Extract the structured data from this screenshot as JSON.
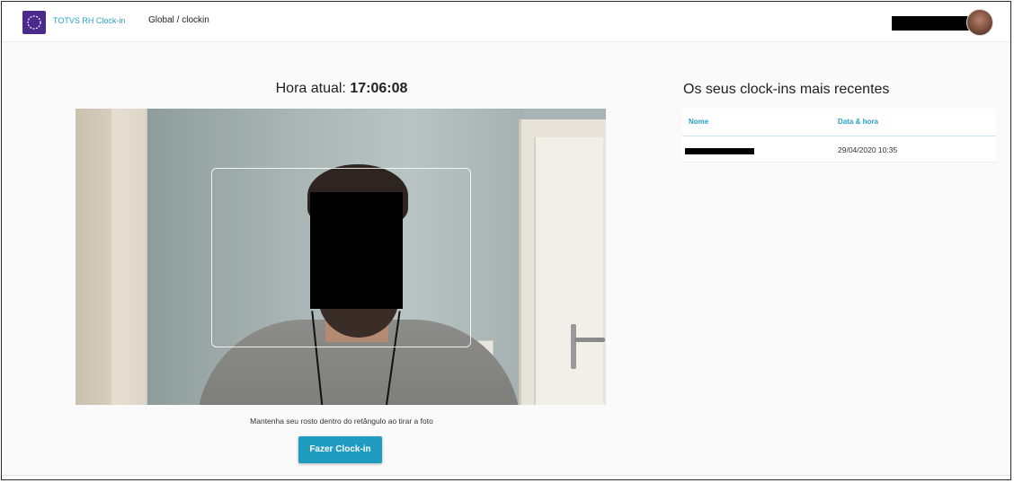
{
  "header": {
    "app_name": "TOTVS RH Clock-in",
    "breadcrumb": "Global  / clockin"
  },
  "clock": {
    "label": "Hora atual:",
    "time": "17:06:08"
  },
  "camera": {
    "hint": "Mantenha seu rosto dentro do retângulo ao tirar a foto",
    "button_label": "Fazer Clock-in"
  },
  "recent": {
    "title": "Os seus clock-ins mais recentes",
    "columns": [
      "Nome",
      "Data & hora"
    ],
    "rows": [
      {
        "datetime": "29/04/2020 10:35"
      }
    ]
  },
  "colors": {
    "accent": "#1f9cc0",
    "logo_bg": "#4a2a8c",
    "header_link": "#2aa0c8"
  }
}
